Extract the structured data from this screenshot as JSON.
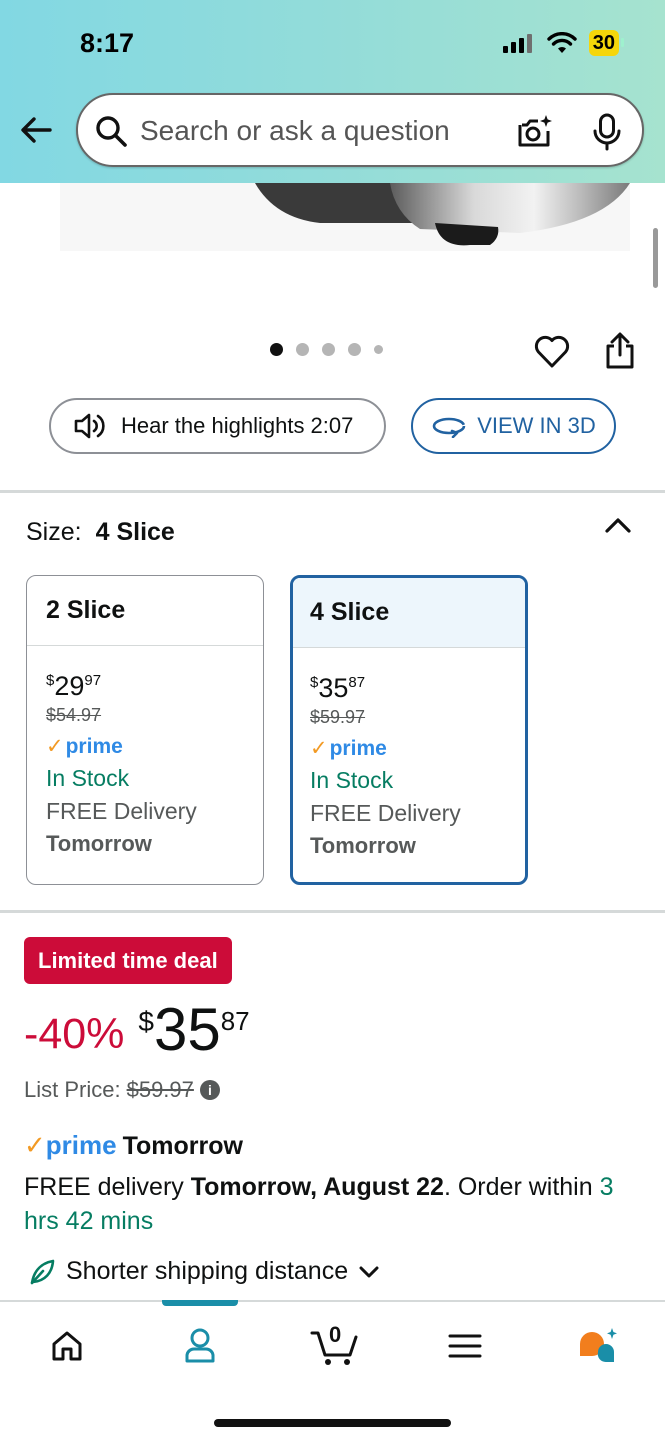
{
  "status_bar": {
    "time": "8:17",
    "battery": "30"
  },
  "search": {
    "placeholder": "Search or ask a question"
  },
  "gallery": {
    "dots": 5,
    "active_dot": 1
  },
  "actions": {
    "hear_highlights": "Hear the highlights 2:07",
    "view_3d": "VIEW IN 3D"
  },
  "size": {
    "label": "Size:",
    "selected": "4 Slice",
    "options": [
      {
        "name": "2 Slice",
        "currency": "$",
        "whole": "29",
        "fraction": "97",
        "list_price": "$54.97",
        "prime": "prime",
        "stock": "In Stock",
        "delivery": "FREE Delivery",
        "day": "Tomorrow",
        "selected": false
      },
      {
        "name": "4 Slice",
        "currency": "$",
        "whole": "35",
        "fraction": "87",
        "list_price": "$59.97",
        "prime": "prime",
        "stock": "In Stock",
        "delivery": "FREE Delivery",
        "day": "Tomorrow",
        "selected": true
      }
    ]
  },
  "deal": {
    "badge": "Limited time deal",
    "discount": "-40%",
    "currency": "$",
    "whole": "35",
    "fraction": "87",
    "list_price_label": "List Price:",
    "list_price": "$59.97"
  },
  "delivery": {
    "prime": "prime",
    "prime_day": "Tomorrow",
    "text_pre": "FREE delivery ",
    "date": "Tomorrow, August 22",
    "text_mid": ". Order within ",
    "countdown": "3 hrs 42 mins",
    "shipping": "Shorter shipping distance"
  },
  "bottom_nav": {
    "cart_count": "0"
  },
  "colors": {
    "accent": "#2162a1",
    "deal_red": "#cc0c39",
    "stock_green": "#067d62",
    "prime_blue": "#2f8ae5",
    "prime_check": "#f29a24",
    "nav_active": "#1a8ea8"
  }
}
